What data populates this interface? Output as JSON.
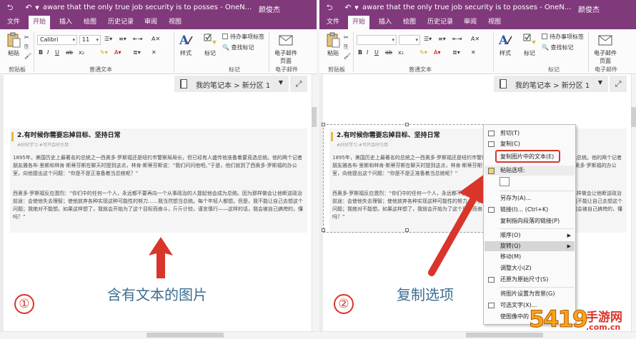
{
  "app": {
    "window_title": "aware that the only true job security is to posses  -  OneN...",
    "user_name": "颜俊杰"
  },
  "menu_tabs": [
    "文件",
    "开始",
    "插入",
    "绘图",
    "历史记录",
    "审阅",
    "视图"
  ],
  "active_tab": "开始",
  "ribbon": {
    "paste_label": "粘贴",
    "clipboard_group": "剪贴板",
    "font_name": "Calibri",
    "font_size": "11",
    "text_group": "普通文本",
    "styles_label": "样式",
    "tag_label": "标记",
    "todo_tag_label": "待办事项标签",
    "find_tags_label": "查找标记",
    "tags_group": "标记",
    "email_page_label": "电子邮件页面",
    "email_group": "电子邮件"
  },
  "notebook_nav": {
    "path": "我的笔记本 > 新分区 1"
  },
  "article": {
    "heading": "2.有时候你需要忘掉目标、坚持日常",
    "tags": "#好好学习 #可开会时引用",
    "paragraph1": "1895年，美国历史上最著名的总统之一西奥多·罗斯福还是纽约市警察局局长，但已经有人盛传他准备着要竞选总统。他的两个记者朋友雅各布·里斯和林肯·斯蒂芬斯在聊天时提到这点，林肯·斯蒂芬斯说：“我们问问他吧。”于是，他们就到了西奥多·罗斯福的办公室，向他提出这个问题：“你是不是正准备着当总统呢？”",
    "paragraph2": "西奥多·罗斯福反应激烈：“你们中的任何一个人，永远都不要再向一个从事政治的人提起他会成为总统。因为那样做会让他断送政治前途：会使他失去理智；使他放弃各种实现这种可能性的努力……我当然想当总统。每个年轻人都想。但是，我不能让自己去想这个问题；我绝对不能想。如果这样想了，我就会开始为了这个目标而奋斗，斤斤计较，谨言慎行——这样的话，我会被自己搞垮的，懂吗？”"
  },
  "captions": {
    "left_number": "①",
    "left_text": "含有文本的图片",
    "right_number": "②",
    "right_text": "复制选项"
  },
  "context_menu": {
    "items": [
      {
        "label": "剪切(T)",
        "icon": "scissors-icon"
      },
      {
        "label": "复制(C)",
        "icon": "copy-icon"
      },
      {
        "label": "复制图片中的文本(E)",
        "icon": "",
        "highlighted": true
      },
      {
        "label": "粘贴选项:",
        "icon": "clipboard-icon",
        "header": true
      },
      {
        "label": "另存为(A)...",
        "icon": ""
      },
      {
        "label": "链接(I)...  (Ctrl+K)",
        "icon": "link-icon"
      },
      {
        "label": "复制指向段落的链接(P)",
        "icon": ""
      },
      {
        "label": "顺序(O)",
        "icon": "",
        "submenu": true
      },
      {
        "label": "旋转(Q)",
        "icon": "",
        "submenu": true
      },
      {
        "label": "移动(M)",
        "icon": ""
      },
      {
        "label": "调整大小(Z)",
        "icon": ""
      },
      {
        "label": "还原为原始尺寸(S)",
        "icon": ""
      },
      {
        "label": "将图片设置为背景(G)",
        "icon": ""
      },
      {
        "label": "可选文字(X)...",
        "icon": ""
      },
      {
        "label": "使图像中的",
        "icon": ""
      }
    ]
  },
  "watermark": {
    "number": "5419",
    "text": "手游网",
    "url": ".com.cn"
  },
  "colors": {
    "onenote_purple": "#80397b",
    "annotation_red": "#d9352b",
    "caption_blue": "#3c6e8f"
  }
}
